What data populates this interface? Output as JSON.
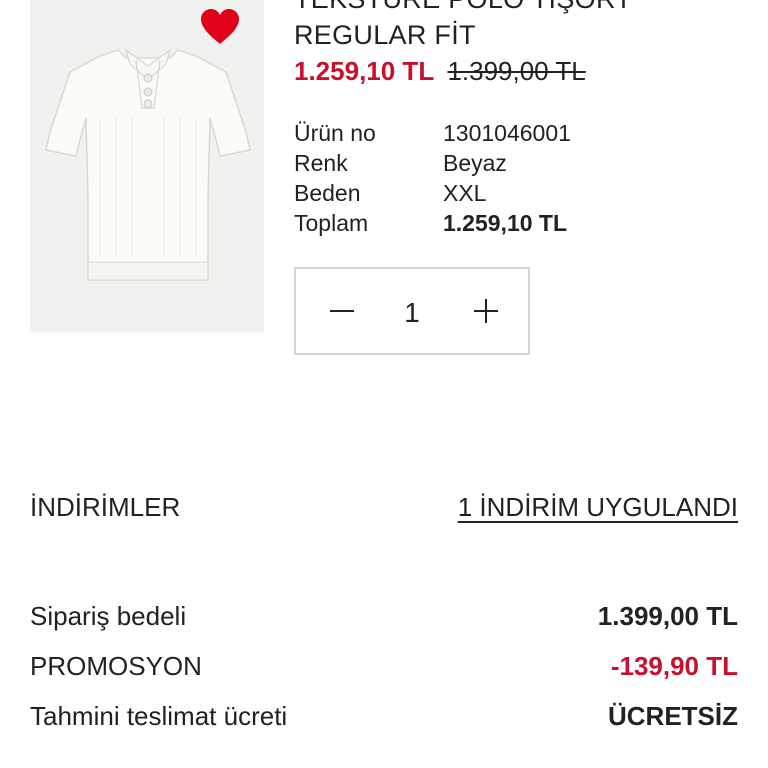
{
  "product": {
    "title_line1": "TEKSTÜRE POLO TİŞÖRT",
    "title_line2": "REGULAR FİT",
    "price_sale": "1.259,10 TL",
    "price_original": "1.399,00 TL",
    "favorite_icon": "heart-icon",
    "favorite_color": "#e2001a"
  },
  "details": {
    "rows": [
      {
        "label": "Ürün no",
        "value": "1301046001"
      },
      {
        "label": "Renk",
        "value": "Beyaz"
      },
      {
        "label": "Beden",
        "value": "XXL"
      },
      {
        "label": "Toplam",
        "value": "1.259,10 TL"
      }
    ]
  },
  "quantity": {
    "value": "1",
    "decrease_icon": "minus-icon",
    "increase_icon": "plus-icon"
  },
  "discounts": {
    "label": "İNDİRİMLER",
    "link": "1 İNDİRİM UYGULANDI"
  },
  "summary": {
    "order_label": "Sipariş bedeli",
    "order_value": "1.399,00 TL",
    "promo_label": "PROMOSYON",
    "promo_value": "-139,90 TL",
    "shipping_label": "Tahmini teslimat ücreti",
    "shipping_value": "ÜCRETSİZ"
  },
  "colors": {
    "sale_red": "#c8102e",
    "text": "#222222",
    "border": "#d4d4d4"
  }
}
